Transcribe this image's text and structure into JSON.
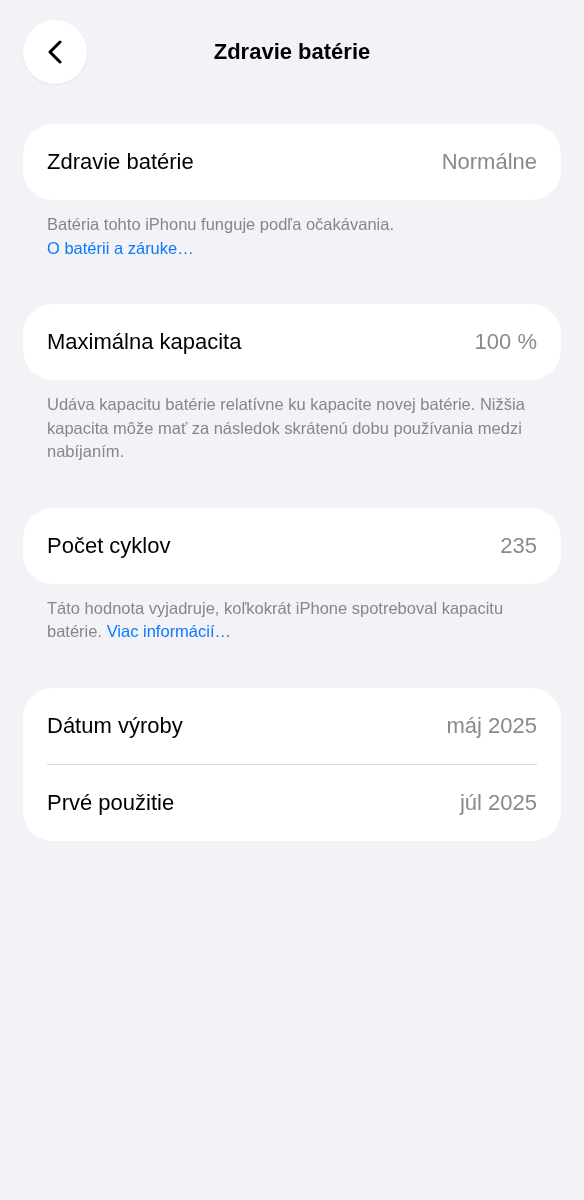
{
  "nav": {
    "title": "Zdravie batérie"
  },
  "sections": [
    {
      "rows": [
        {
          "label": "Zdravie batérie",
          "value": "Normálne"
        }
      ],
      "footer": {
        "text": "Batéria tohto iPhonu funguje podľa očakávania.",
        "link": "O batérii a záruke…"
      }
    },
    {
      "rows": [
        {
          "label": "Maximálna kapacita",
          "value": "100 %"
        }
      ],
      "footer": {
        "text": "Udáva kapacitu batérie relatívne ku kapacite novej batérie. Nižšia kapacita môže mať za následok skrátenú dobu používania medzi nabíjaním."
      }
    },
    {
      "rows": [
        {
          "label": "Počet cyklov",
          "value": "235"
        }
      ],
      "footer": {
        "text": "Táto hodnota vyjadruje, koľkokrát iPhone spotreboval kapacitu batérie.",
        "link": "Viac informácií…"
      }
    },
    {
      "rows": [
        {
          "label": "Dátum výroby",
          "value": "máj 2025"
        },
        {
          "label": "Prvé použitie",
          "value": "júl 2025"
        }
      ]
    }
  ]
}
